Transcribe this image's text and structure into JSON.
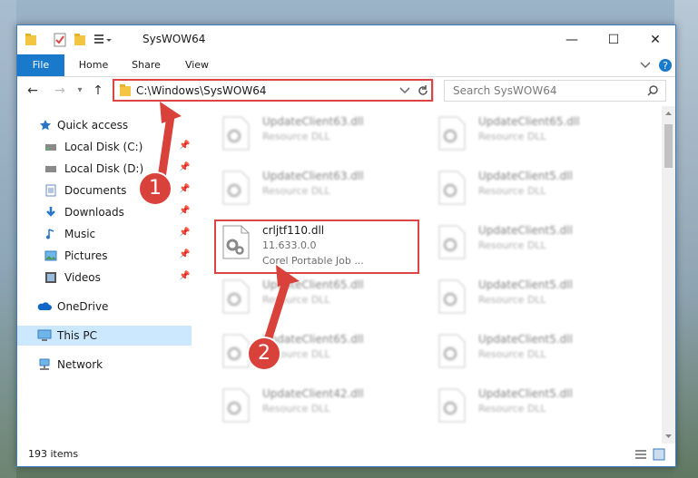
{
  "window": {
    "title": "SysWOW64",
    "minimize_label": "—",
    "maximize_label": "☐",
    "close_label": "✕"
  },
  "ribbon": {
    "tabs": [
      "File",
      "Home",
      "Share",
      "View"
    ]
  },
  "address": {
    "path": "C:\\Windows\\SysWOW64",
    "search_placeholder": "Search SysWOW64"
  },
  "sidebar": {
    "quick_access": "Quick access",
    "items": [
      {
        "label": "Local Disk (C:)",
        "icon": "drive-icon"
      },
      {
        "label": "Local Disk (D:)",
        "icon": "drive-icon"
      },
      {
        "label": "Documents",
        "icon": "documents-icon"
      },
      {
        "label": "Downloads",
        "icon": "downloads-icon"
      },
      {
        "label": "Music",
        "icon": "music-icon"
      },
      {
        "label": "Pictures",
        "icon": "pictures-icon"
      },
      {
        "label": "Videos",
        "icon": "videos-icon"
      }
    ],
    "onedrive": "OneDrive",
    "this_pc": "This PC",
    "network": "Network"
  },
  "files": {
    "left": [
      {
        "name": "UpdateClient63.dll",
        "type": "Resource DLL"
      },
      {
        "name": "UpdateClient63.dll",
        "type": "Resource DLL"
      },
      {
        "name": "crljtf110.dll",
        "version": "11.633.0.0",
        "desc": "Corel Portable Job ..."
      },
      {
        "name": "UpdateClient65.dll",
        "type": "Resource DLL"
      },
      {
        "name": "UpdateClient65.dll",
        "type": "Resource DLL"
      },
      {
        "name": "UpdateClient42.dll",
        "type": "Resource DLL"
      }
    ],
    "right": [
      {
        "name": "UpdateClient65.dll",
        "type": "Resource DLL"
      },
      {
        "name": "UpdateClient5.dll",
        "type": "Resource DLL"
      },
      {
        "name": "UpdateClient5.dll",
        "type": "Resource DLL"
      },
      {
        "name": "UpdateClient5.dll",
        "type": "Resource DLL"
      },
      {
        "name": "UpdateClient5.dll",
        "type": "Resource DLL"
      },
      {
        "name": "UpdateClient5.dll",
        "type": "Resource DLL"
      }
    ]
  },
  "status": {
    "count": "193 items"
  },
  "callouts": [
    "1",
    "2"
  ],
  "colors": {
    "accent": "#1979ca",
    "highlight": "#d44444",
    "selection": "#cce8ff"
  }
}
